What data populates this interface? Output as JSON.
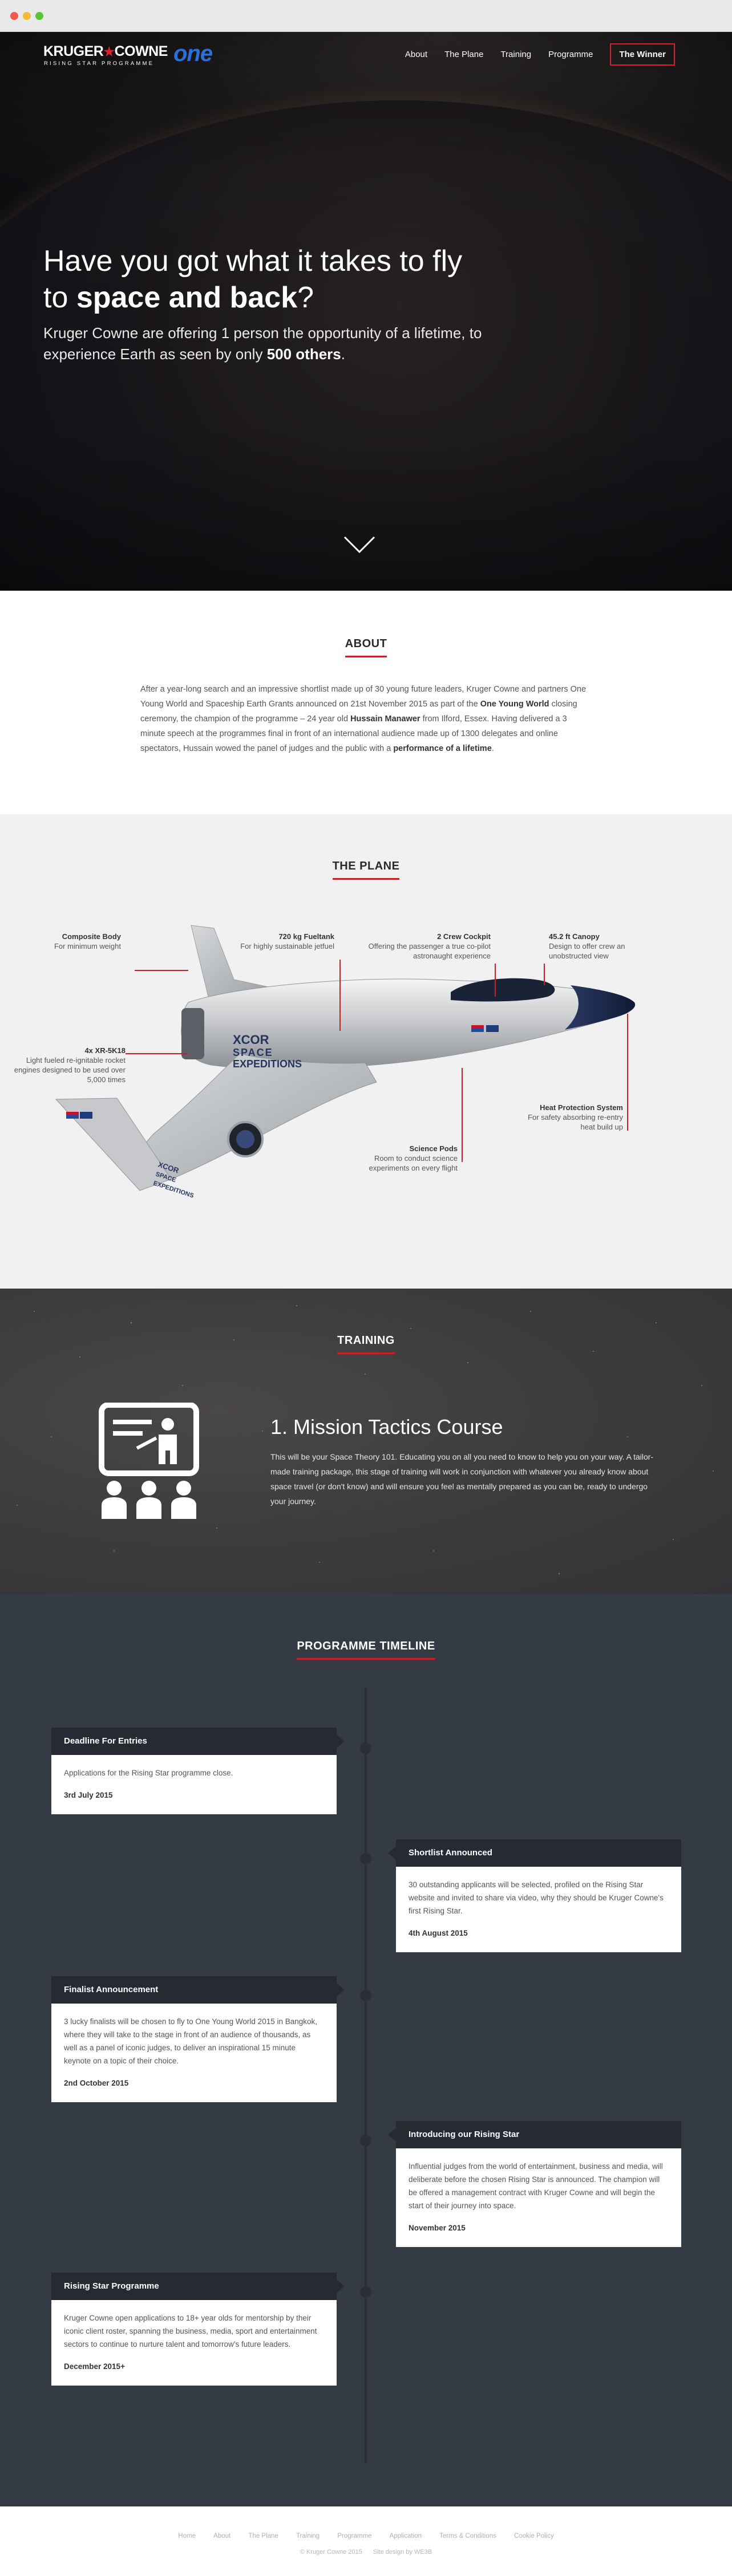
{
  "brand": {
    "logo_main_left": "KRUGER",
    "logo_main_right": "COWNE",
    "logo_sub": "RISING STAR PROGRAMME",
    "logo_one": "one"
  },
  "nav": {
    "items": [
      "About",
      "The Plane",
      "Training",
      "Programme"
    ],
    "cta": "The Winner"
  },
  "hero": {
    "line1": "Have you got what it takes to fly",
    "line2_pre": "to ",
    "line2_strong": "space and back",
    "line2_post": "?",
    "p_pre": "Kruger Cowne are offering 1 person the opportunity of a lifetime, to experience Earth as seen by only ",
    "p_strong": "500 others",
    "p_post": "."
  },
  "about": {
    "title": "ABOUT",
    "t1": "After a year-long search and an impressive shortlist made up of 30 young future leaders, Kruger Cowne and partners One Young World and Spaceship Earth Grants announced on 21st November 2015 as part of the ",
    "b1": "One Young World",
    "t2": " closing ceremony, the champion of the programme – 24 year old ",
    "b2": "Hussain Manawer",
    "t3": " from Ilford, Essex. Having delivered a 3 minute speech at the programmes final in front of an international audience made up of 1300 delegates and online spectators, Hussain wowed the panel of judges and the public with a ",
    "b3": "performance of a lifetime",
    "t4": "."
  },
  "plane": {
    "title": "THE PLANE",
    "fuselage_text": [
      "XCOR",
      "SPACE",
      "EXPEDITIONS"
    ],
    "callouts": [
      {
        "title": "Composite Body",
        "desc": "For minimum weight"
      },
      {
        "title": "720 kg Fueltank",
        "desc": "For highly sustainable jetfuel"
      },
      {
        "title": "2 Crew Cockpit",
        "desc": "Offering the passenger a true co-pilot astronaught experience"
      },
      {
        "title": "45.2 ft Canopy",
        "desc": "Design to offer crew an unobstructed view"
      },
      {
        "title": "4x XR-5K18",
        "desc": "Light fueled re-ignitable rocket engines designed to be used over 5,000 times"
      },
      {
        "title": "Heat Protection System",
        "desc": "For safety absorbing re-entry heat build up"
      },
      {
        "title": "Science Pods",
        "desc": "Room to conduct science experiments on every flight"
      }
    ]
  },
  "training": {
    "title": "TRAINING",
    "heading": "1. Mission Tactics Course",
    "body": "This will be your Space Theory 101. Educating you on all you need to know to help you on your way. A tailor-made training package, this stage of training will work in conjunction with whatever you already know about space travel (or don't know) and will ensure you feel as mentally prepared as you can be, ready to undergo your journey."
  },
  "timeline": {
    "title": "PROGRAMME TIMELINE",
    "items": [
      {
        "title": "Deadline For Entries",
        "body": "Applications for the Rising Star programme close.",
        "date": "3rd July 2015"
      },
      {
        "title": "Shortlist Announced",
        "body": "30 outstanding applicants will be selected, profiled on the Rising Star website and invited to share via video, why they should be Kruger Cowne's first Rising Star.",
        "date": "4th August 2015"
      },
      {
        "title": "Finalist Announcement",
        "body": "3 lucky finalists will be chosen to fly to One Young World 2015 in Bangkok, where they will take to the stage in front of an audience of thousands, as well as a panel of iconic judges, to deliver an inspirational 15 minute keynote on a topic of their choice.",
        "date": "2nd October 2015"
      },
      {
        "title": "Introducing our Rising Star",
        "body": "Influential judges from the world of entertainment, business and media, will deliberate before the chosen Rising Star is announced. The champion will be offered a management contract with Kruger Cowne and will begin the start of their journey into space.",
        "date": "November 2015"
      },
      {
        "title": "Rising Star Programme",
        "body": "Kruger Cowne open applications to 18+ year olds for mentorship by their iconic client roster, spanning the business, media, sport and entertainment sectors to continue to nurture talent and tomorrow's future leaders.",
        "date": "December 2015+"
      }
    ]
  },
  "footer": {
    "links": [
      "Home",
      "About",
      "The Plane",
      "Training",
      "Programme",
      "Application",
      "Terms & Conditions",
      "Cookie Policy"
    ],
    "copyright": "© Kruger Cowne 2015",
    "credit": "Site design by WE3B"
  },
  "colors": {
    "accent_red": "#c62028",
    "one_blue": "#2c6fd6",
    "training_bg": "#3b3a3c",
    "timeline_bg": "#353b45",
    "card_header": "#262b33"
  }
}
